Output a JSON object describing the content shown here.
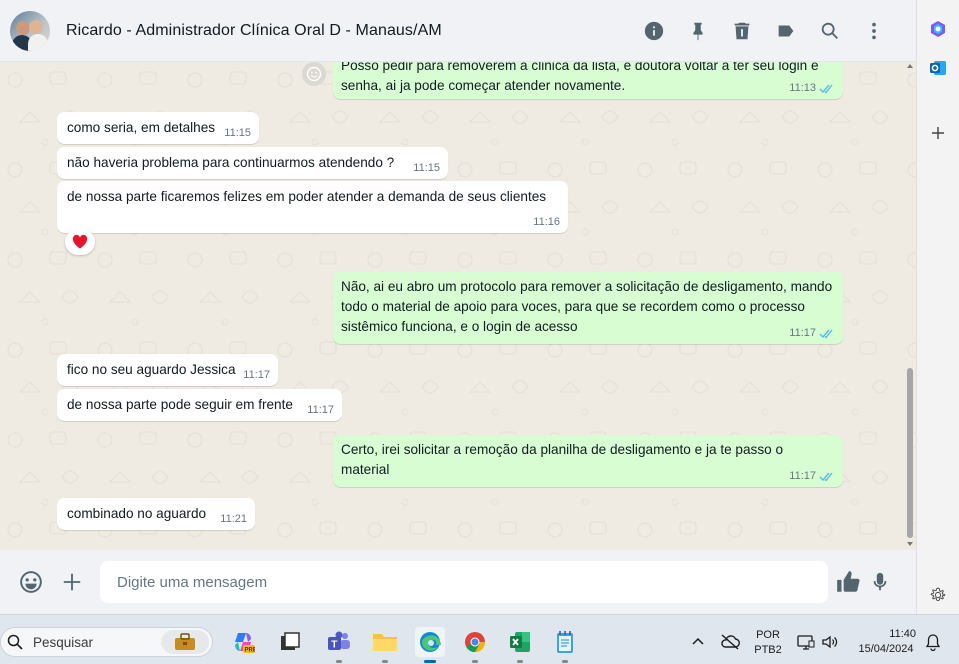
{
  "header": {
    "contact_name": "Ricardo - Administrador Clínica Oral D - Manaus/AM",
    "actions": [
      "info-icon",
      "pin-icon",
      "delete-icon",
      "label-icon",
      "search-icon",
      "menu-icon"
    ]
  },
  "messages": [
    {
      "dir": "out",
      "text": "Posso pedir para removerem a clinica da lista, e doutora voltar a ter seu login e senha, ai ja pode começar atender novamente.",
      "time": "11:13",
      "read": true
    },
    {
      "dir": "in",
      "text": "como seria, em detalhes",
      "time": "11:15"
    },
    {
      "dir": "in",
      "text": "não haveria problema para continuarmos atendendo ?",
      "time": "11:15"
    },
    {
      "dir": "in",
      "text": "de nossa parte ficaremos felizes em poder atender a demanda de seus clientes",
      "time": "11:16",
      "reaction": "❤️"
    },
    {
      "dir": "out",
      "text": "Não, ai eu abro um protocolo para remover a solicitação de desligamento, mando todo o material de apoio para voces, para que se recordem como o processo sistêmico funciona, e o login de acesso",
      "time": "11:17",
      "read": true
    },
    {
      "dir": "in",
      "text": "fico no seu aguardo Jessica",
      "time": "11:17"
    },
    {
      "dir": "in",
      "text": "de nossa parte pode seguir em frente",
      "time": "11:17"
    },
    {
      "dir": "out",
      "text": "Certo, irei solicitar a remoção da planilha de desligamento e ja te passo o material",
      "time": "11:17",
      "read": true
    },
    {
      "dir": "in",
      "text": "combinado no aguardo",
      "time": "11:21"
    }
  ],
  "composer": {
    "placeholder": "Digite uma mensagem"
  },
  "taskbar": {
    "search_label": "Pesquisar",
    "language_line1": "POR",
    "language_line2": "PTB2",
    "clock_time": "11:40",
    "clock_date": "15/04/2024"
  },
  "colors": {
    "outgoing_bubble": "#d9fdd3",
    "incoming_bubble": "#ffffff",
    "chat_background": "#efeae2",
    "read_ticks": "#53bdeb"
  }
}
